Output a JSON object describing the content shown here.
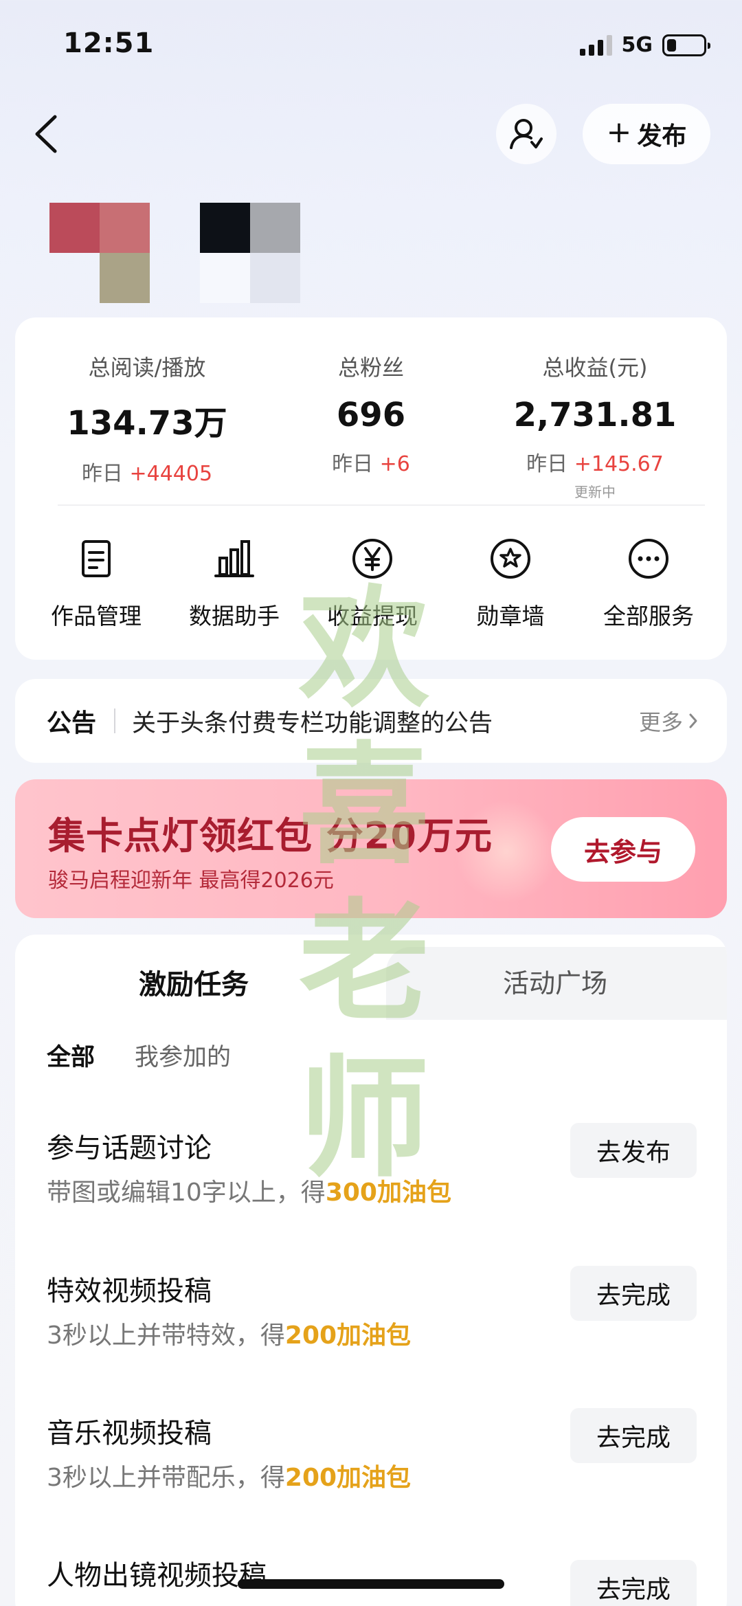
{
  "status_bar": {
    "time": "12:51",
    "network": "5G",
    "battery_percent": 25
  },
  "nav": {
    "publish_label": "发布"
  },
  "stats": [
    {
      "label": "总阅读/播放",
      "value": "134.73万",
      "yesterday_prefix": "昨日",
      "yesterday_delta": "+44405",
      "note": ""
    },
    {
      "label": "总粉丝",
      "value": "696",
      "yesterday_prefix": "昨日",
      "yesterday_delta": "+6",
      "note": ""
    },
    {
      "label": "总收益(元)",
      "value": "2,731.81",
      "yesterday_prefix": "昨日",
      "yesterday_delta": "+145.67",
      "note": "更新中"
    }
  ],
  "services": [
    {
      "label": "作品管理",
      "icon": "document-icon"
    },
    {
      "label": "数据助手",
      "icon": "bar-chart-icon"
    },
    {
      "label": "收益提现",
      "icon": "yuan-icon"
    },
    {
      "label": "勋章墙",
      "icon": "badge-icon"
    },
    {
      "label": "全部服务",
      "icon": "more-icon"
    }
  ],
  "notice": {
    "tag": "公告",
    "text": "关于头条付费专栏功能调整的公告",
    "more": "更多"
  },
  "banner": {
    "title": "集卡点灯领红包 分20万元",
    "subtitle": "骏马启程迎新年 最高得2026元",
    "button": "去参与"
  },
  "tasks": {
    "tabs": [
      "激励任务",
      "活动广场"
    ],
    "filters": [
      "全部",
      "我参加的"
    ],
    "items": [
      {
        "title": "参与话题讨论",
        "desc": "带图或编辑10字以上，得",
        "reward": "300加油包",
        "button": "去发布"
      },
      {
        "title": "特效视频投稿",
        "desc": "3秒以上并带特效，得",
        "reward": "200加油包",
        "button": "去完成"
      },
      {
        "title": "音乐视频投稿",
        "desc": "3秒以上并带配乐，得",
        "reward": "200加油包",
        "button": "去完成"
      },
      {
        "title": "人物出镜视频投稿",
        "desc": "",
        "reward": "",
        "button": "去完成"
      }
    ]
  },
  "watermark": {
    "text": "欢喜老师"
  },
  "colors": {
    "accent_red": "#e8433f",
    "reward_orange": "#e5a21a",
    "banner_red": "#a81d2f"
  }
}
